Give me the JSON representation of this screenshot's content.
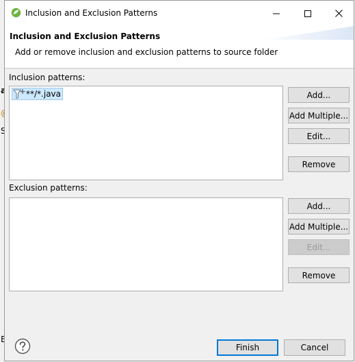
{
  "background": {
    "fragments": [
      "a",
      "@",
      "S",
      "B"
    ]
  },
  "window": {
    "title": "Inclusion and Exclusion Patterns",
    "minimize_icon": "minimize-icon",
    "maximize_icon": "maximize-icon",
    "close_icon": "close-icon"
  },
  "banner": {
    "title": "Inclusion and Exclusion Patterns",
    "description": "Add or remove inclusion and exclusion patterns to source folder"
  },
  "inclusion": {
    "label": "Inclusion patterns:",
    "items": [
      "**/*.java"
    ],
    "buttons": {
      "add": "Add...",
      "add_multiple": "Add Multiple...",
      "edit": "Edit...",
      "remove": "Remove"
    }
  },
  "exclusion": {
    "label": "Exclusion patterns:",
    "items": [],
    "buttons": {
      "add": "Add...",
      "add_multiple": "Add Multiple...",
      "edit": "Edit...",
      "remove": "Remove"
    }
  },
  "footer": {
    "help_icon": "help-icon",
    "finish": "Finish",
    "cancel": "Cancel"
  },
  "colors": {
    "accent": "#0078d7",
    "selection": "#cce8ff",
    "app_icon": "#6db33f"
  }
}
